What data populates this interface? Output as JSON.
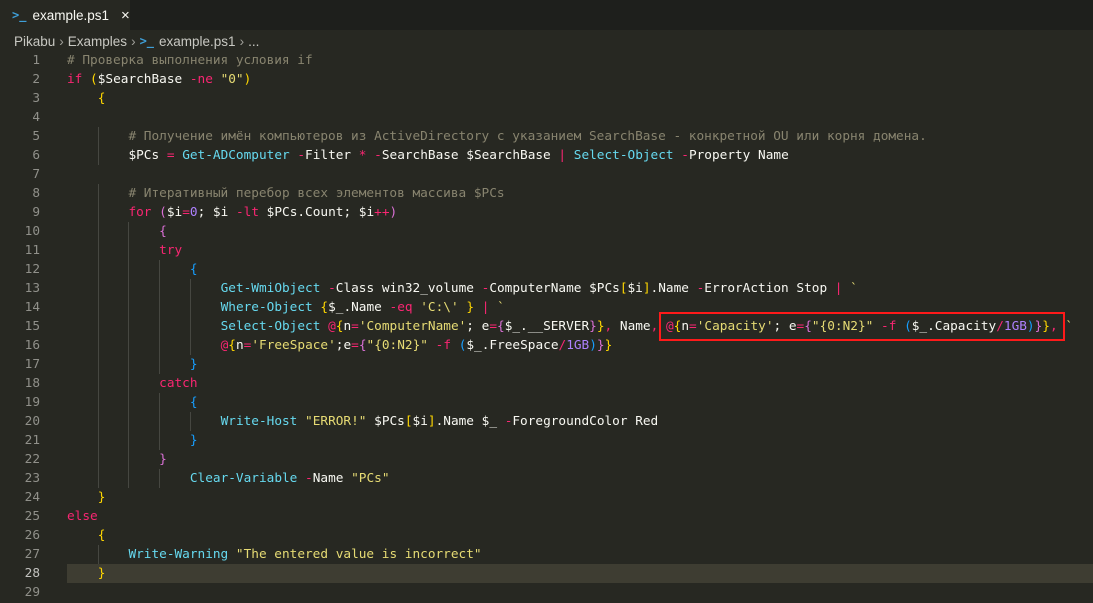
{
  "tab": {
    "icon": "powershell-icon",
    "title": "example.ps1",
    "close": "×"
  },
  "breadcrumb": [
    "Pikabu",
    "Examples",
    "example.ps1",
    "..."
  ],
  "editor": {
    "current_line": 28,
    "lines": [
      [
        [
          "c",
          "# Проверка выполнения условия if"
        ]
      ],
      [
        [
          "k",
          "if"
        ],
        [
          "t",
          " "
        ],
        [
          "b1",
          "("
        ],
        [
          "t",
          "$SearchBase "
        ],
        [
          "k",
          "-ne"
        ],
        [
          "t",
          " "
        ],
        [
          "s",
          "\"0\""
        ],
        [
          "b1",
          ")"
        ]
      ],
      [
        [
          "t",
          "    "
        ],
        [
          "b1",
          "{"
        ]
      ],
      [],
      [
        [
          "t",
          "        "
        ],
        [
          "c",
          "# Получение имён компьютеров из ActiveDirectory с указанием SearchBase - конкретной OU или корня домена."
        ]
      ],
      [
        [
          "t",
          "        "
        ],
        [
          "t",
          "$PCs "
        ],
        [
          "k",
          "="
        ],
        [
          "t",
          " "
        ],
        [
          "f",
          "Get-ADComputer"
        ],
        [
          "t",
          " "
        ],
        [
          "k",
          "-"
        ],
        [
          "t",
          "Filter "
        ],
        [
          "k",
          "*"
        ],
        [
          "t",
          " "
        ],
        [
          "k",
          "-"
        ],
        [
          "t",
          "SearchBase $SearchBase "
        ],
        [
          "k",
          "|"
        ],
        [
          "t",
          " "
        ],
        [
          "f",
          "Select-Object"
        ],
        [
          "t",
          " "
        ],
        [
          "k",
          "-"
        ],
        [
          "t",
          "Property Name"
        ]
      ],
      [],
      [
        [
          "t",
          "        "
        ],
        [
          "c",
          "# Итеративный перебор всех элементов массива $PCs"
        ]
      ],
      [
        [
          "t",
          "        "
        ],
        [
          "k",
          "for"
        ],
        [
          "t",
          " "
        ],
        [
          "b2",
          "("
        ],
        [
          "t",
          "$i"
        ],
        [
          "k",
          "="
        ],
        [
          "n",
          "0"
        ],
        [
          "t",
          "; $i "
        ],
        [
          "k",
          "-lt"
        ],
        [
          "t",
          " $PCs.Count; $i"
        ],
        [
          "k",
          "++"
        ],
        [
          "b2",
          ")"
        ]
      ],
      [
        [
          "t",
          "            "
        ],
        [
          "b2",
          "{"
        ]
      ],
      [
        [
          "t",
          "            "
        ],
        [
          "k",
          "try"
        ]
      ],
      [
        [
          "t",
          "                "
        ],
        [
          "b3",
          "{"
        ]
      ],
      [
        [
          "t",
          "                    "
        ],
        [
          "f",
          "Get-WmiObject"
        ],
        [
          "t",
          " "
        ],
        [
          "k",
          "-"
        ],
        [
          "t",
          "Class win32_volume "
        ],
        [
          "k",
          "-"
        ],
        [
          "t",
          "ComputerName $PCs"
        ],
        [
          "b1",
          "["
        ],
        [
          "t",
          "$i"
        ],
        [
          "b1",
          "]"
        ],
        [
          "t",
          ".Name "
        ],
        [
          "k",
          "-"
        ],
        [
          "t",
          "ErrorAction Stop "
        ],
        [
          "k",
          "|"
        ],
        [
          "t",
          " "
        ],
        [
          "s",
          "`"
        ]
      ],
      [
        [
          "t",
          "                    "
        ],
        [
          "f",
          "Where-Object"
        ],
        [
          "t",
          " "
        ],
        [
          "b1",
          "{"
        ],
        [
          "t",
          "$_.Name "
        ],
        [
          "k",
          "-eq"
        ],
        [
          "t",
          " "
        ],
        [
          "s",
          "'C:\\'"
        ],
        [
          "t",
          " "
        ],
        [
          "b1",
          "}"
        ],
        [
          "t",
          " "
        ],
        [
          "k",
          "|"
        ],
        [
          "t",
          " "
        ],
        [
          "s",
          "`"
        ]
      ],
      [
        [
          "t",
          "                    "
        ],
        [
          "f",
          "Select-Object"
        ],
        [
          "t",
          " "
        ],
        [
          "k",
          "@"
        ],
        [
          "b1",
          "{"
        ],
        [
          "t",
          "n"
        ],
        [
          "k",
          "="
        ],
        [
          "s",
          "'ComputerName'"
        ],
        [
          "t",
          "; e"
        ],
        [
          "k",
          "="
        ],
        [
          "b2",
          "{"
        ],
        [
          "t",
          "$_.__SERVER"
        ],
        [
          "b2",
          "}"
        ],
        [
          "b1",
          "}"
        ],
        [
          "k",
          ","
        ],
        [
          "t",
          " Name"
        ],
        [
          "k",
          ","
        ],
        [
          "t",
          " "
        ],
        [
          "box",
          [
            [
              "k",
              "@"
            ],
            [
              "b1",
              "{"
            ],
            [
              "t",
              "n"
            ],
            [
              "k",
              "="
            ],
            [
              "s",
              "'Capacity'"
            ],
            [
              "t",
              "; e"
            ],
            [
              "k",
              "="
            ],
            [
              "b2",
              "{"
            ],
            [
              "s",
              "\"{0:N2}\""
            ],
            [
              "t",
              " "
            ],
            [
              "k",
              "-f"
            ],
            [
              "t",
              " "
            ],
            [
              "b3",
              "("
            ],
            [
              "t",
              "$_.Capacity"
            ],
            [
              "k",
              "/"
            ],
            [
              "n",
              "1GB"
            ],
            [
              "b3",
              ")"
            ],
            [
              "b2",
              "}"
            ],
            [
              "b1",
              "}"
            ],
            [
              "k",
              ","
            ]
          ]
        ],
        [
          "t",
          " "
        ],
        [
          "s",
          "`"
        ]
      ],
      [
        [
          "t",
          "                    "
        ],
        [
          "k",
          "@"
        ],
        [
          "b1",
          "{"
        ],
        [
          "t",
          "n"
        ],
        [
          "k",
          "="
        ],
        [
          "s",
          "'FreeSpace'"
        ],
        [
          "t",
          ";e"
        ],
        [
          "k",
          "="
        ],
        [
          "b2",
          "{"
        ],
        [
          "s",
          "\"{0:N2}\""
        ],
        [
          "t",
          " "
        ],
        [
          "k",
          "-f"
        ],
        [
          "t",
          " "
        ],
        [
          "b3",
          "("
        ],
        [
          "t",
          "$_.FreeSpace"
        ],
        [
          "k",
          "/"
        ],
        [
          "n",
          "1GB"
        ],
        [
          "b3",
          ")"
        ],
        [
          "b2",
          "}"
        ],
        [
          "b1",
          "}"
        ]
      ],
      [
        [
          "t",
          "                "
        ],
        [
          "b3",
          "}"
        ]
      ],
      [
        [
          "t",
          "            "
        ],
        [
          "k",
          "catch"
        ]
      ],
      [
        [
          "t",
          "                "
        ],
        [
          "b3",
          "{"
        ]
      ],
      [
        [
          "t",
          "                    "
        ],
        [
          "f",
          "Write-Host"
        ],
        [
          "t",
          " "
        ],
        [
          "s",
          "\"ERROR!\""
        ],
        [
          "t",
          " $PCs"
        ],
        [
          "b1",
          "["
        ],
        [
          "t",
          "$i"
        ],
        [
          "b1",
          "]"
        ],
        [
          "t",
          ".Name $_ "
        ],
        [
          "k",
          "-"
        ],
        [
          "t",
          "ForegroundColor Red"
        ]
      ],
      [
        [
          "t",
          "                "
        ],
        [
          "b3",
          "}"
        ]
      ],
      [
        [
          "t",
          "            "
        ],
        [
          "b2",
          "}"
        ]
      ],
      [
        [
          "t",
          "                "
        ],
        [
          "f",
          "Clear-Variable"
        ],
        [
          "t",
          " "
        ],
        [
          "k",
          "-"
        ],
        [
          "t",
          "Name "
        ],
        [
          "s",
          "\"PCs\""
        ]
      ],
      [
        [
          "t",
          "    "
        ],
        [
          "b1",
          "}"
        ]
      ],
      [
        [
          "k",
          "else"
        ]
      ],
      [
        [
          "t",
          "    "
        ],
        [
          "b1",
          "{"
        ]
      ],
      [
        [
          "t",
          "        "
        ],
        [
          "f",
          "Write-Warning"
        ],
        [
          "t",
          " "
        ],
        [
          "s",
          "\"The entered value is incorrect\""
        ]
      ],
      [
        [
          "t",
          "    "
        ],
        [
          "b1",
          "}"
        ]
      ],
      []
    ]
  }
}
